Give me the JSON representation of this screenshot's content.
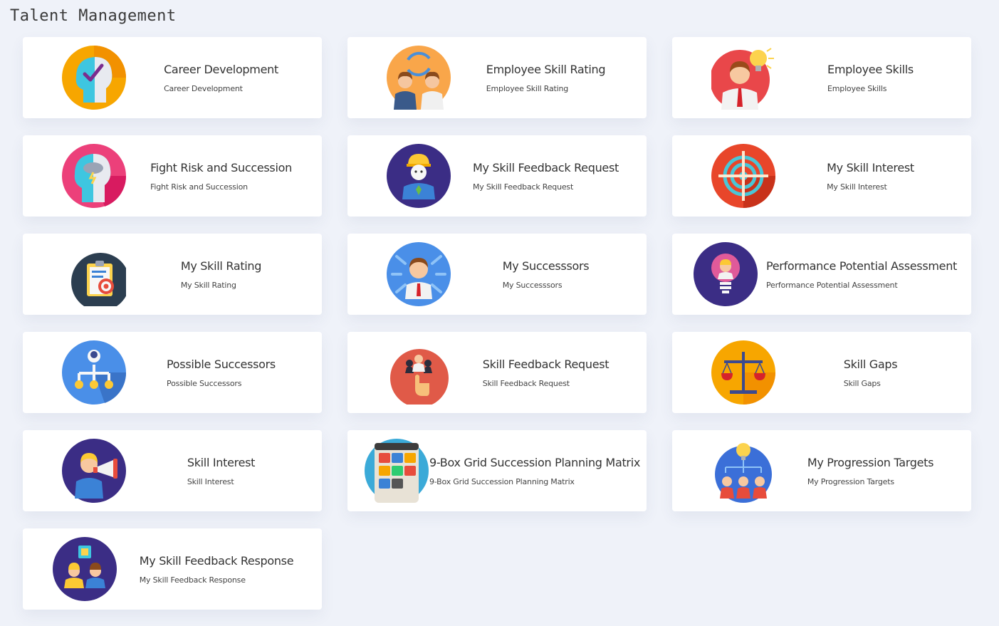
{
  "page": {
    "title": "Talent Management"
  },
  "cards": [
    {
      "id": "career-development",
      "title": "Career Development",
      "subtitle": "Career Development",
      "icon": "career-development-icon"
    },
    {
      "id": "employee-skill-rating",
      "title": "Employee Skill Rating",
      "subtitle": "Employee Skill Rating",
      "icon": "employee-skill-rating-icon"
    },
    {
      "id": "employee-skills",
      "title": "Employee Skills",
      "subtitle": "Employee Skills",
      "icon": "employee-skills-icon"
    },
    {
      "id": "fight-risk-and-succession",
      "title": "Fight Risk and Succession",
      "subtitle": "Fight Risk and Succession",
      "icon": "fight-risk-icon"
    },
    {
      "id": "my-skill-feedback-request",
      "title": "My Skill Feedback Request",
      "subtitle": "My Skill Feedback Request",
      "icon": "my-skill-feedback-request-icon"
    },
    {
      "id": "my-skill-interest",
      "title": "My Skill Interest",
      "subtitle": "My Skill Interest",
      "icon": "target-icon"
    },
    {
      "id": "my-skill-rating",
      "title": "My Skill Rating",
      "subtitle": "My Skill Rating",
      "icon": "clipboard-target-icon"
    },
    {
      "id": "my-successors",
      "title": "My Successsors",
      "subtitle": "My Successsors",
      "icon": "my-successors-icon"
    },
    {
      "id": "performance-potential-assessment",
      "title": "Performance Potential Assessment",
      "subtitle": "Performance Potential Assessment",
      "icon": "lightbulb-person-icon"
    },
    {
      "id": "possible-successors",
      "title": "Possible Successors",
      "subtitle": "Possible Successors",
      "icon": "org-chart-icon"
    },
    {
      "id": "skill-feedback-request",
      "title": "Skill Feedback Request",
      "subtitle": "Skill Feedback Request",
      "icon": "hand-pick-person-icon"
    },
    {
      "id": "skill-gaps",
      "title": "Skill Gaps",
      "subtitle": "Skill Gaps",
      "icon": "balance-scale-icon"
    },
    {
      "id": "skill-interest",
      "title": "Skill Interest",
      "subtitle": "Skill Interest",
      "icon": "megaphone-person-icon"
    },
    {
      "id": "nine-box-grid",
      "title": "9-Box Grid Succession Planning Matrix",
      "subtitle": "9-Box Grid Succession Planning Matrix",
      "icon": "nine-box-grid-icon"
    },
    {
      "id": "my-progression-targets",
      "title": "My Progression Targets",
      "subtitle": "My Progression Targets",
      "icon": "team-idea-icon"
    },
    {
      "id": "my-skill-feedback-response",
      "title": "My Skill Feedback Response",
      "subtitle": "My Skill Feedback Response",
      "icon": "puzzle-team-icon"
    }
  ]
}
